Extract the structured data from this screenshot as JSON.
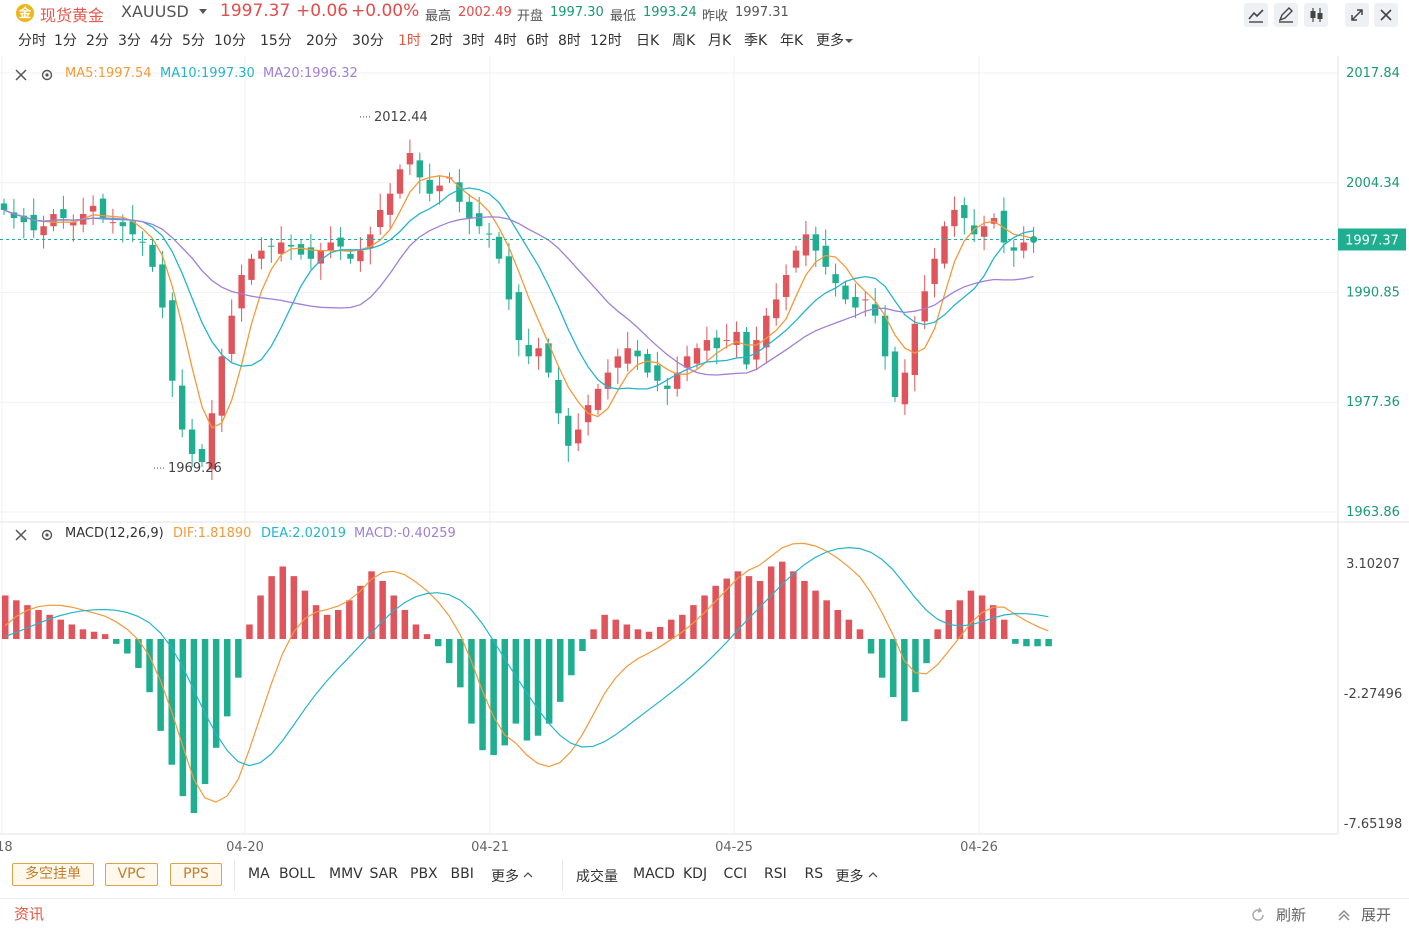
{
  "header": {
    "icon_glyph": "金",
    "name": "现货黄金",
    "code": "XAUUSD",
    "price": "1997.37",
    "change": "+0.06",
    "change_pct": "+0.00%",
    "high_label": "最高",
    "high": "2002.49",
    "open_label": "开盘",
    "open": "1997.30",
    "low_label": "最低",
    "low": "1993.24",
    "prev_label": "昨收",
    "prev": "1997.31"
  },
  "toolbar_icons": [
    "line-tool-icon",
    "draw-tool-icon",
    "candle-type-icon",
    "fullscreen-icon",
    "close-icon"
  ],
  "timeframes": [
    "分时",
    "1分",
    "2分",
    "3分",
    "4分",
    "5分",
    "10分",
    "15分",
    "20分",
    "30分",
    "1时",
    "2时",
    "3时",
    "4时",
    "6时",
    "8时",
    "12时",
    "日K",
    "周K",
    "月K",
    "季K",
    "年K",
    "更多"
  ],
  "active_timeframe": "1时",
  "main_legend": {
    "ma5": "MA5:1997.54",
    "ma10": "MA10:1997.30",
    "ma20": "MA20:1996.32"
  },
  "macd_legend": {
    "name": "MACD(12,26,9)",
    "dif": "DIF:1.81890",
    "dea": "DEA:2.02019",
    "macd": "MACD:-0.40259"
  },
  "colors": {
    "up": "#e0545c",
    "down": "#1fae8f",
    "ma5": "#f39a3b",
    "ma10": "#24b5cc",
    "ma20": "#a07fd6",
    "dif": "#f39a3b",
    "dea": "#24b5cc",
    "axis_text": "#1a9a72"
  },
  "chart_data": {
    "type": "candlestick",
    "x_labels": [
      "-18",
      "04-20",
      "04-21",
      "04-25",
      "04-26"
    ],
    "price_axis": [
      "2017.84",
      "2004.34",
      "1990.85",
      "1977.36",
      "1963.86"
    ],
    "current_price_label": "1997.37",
    "high_marker": "2012.44",
    "low_marker": "1969.26",
    "y_range": [
      1963.86,
      2017.84
    ],
    "close": [
      2001.0,
      2000.0,
      1999.5,
      1998.5,
      1999.0,
      2000.5,
      2000.0,
      1999.5,
      2000.5,
      2001.5,
      2000.0,
      1999.5,
      1999.0,
      1998.0,
      1997.0,
      1994.0,
      1989.0,
      1980.0,
      1974.0,
      1971.0,
      1970.0,
      1976.0,
      1983.0,
      1988.0,
      1993.0,
      1995.0,
      1996.0,
      1996.5,
      1997.0,
      1996.5,
      1995.5,
      1995.0,
      1996.0,
      1997.0,
      1996.5,
      1995.0,
      1996.0,
      1998.0,
      2001.0,
      2003.0,
      2006.0,
      2008.0,
      2005.0,
      2003.0,
      2004.0,
      2005.0,
      2002.0,
      2000.0,
      1999.0,
      1998.0,
      1995.0,
      1990.0,
      1985.0,
      1983.0,
      1984.0,
      1981.0,
      1976.0,
      1972.0,
      1974.0,
      1977.0,
      1979.0,
      1981.0,
      1983.0,
      1984.0,
      1983.0,
      1981.0,
      1980.0,
      1979.0,
      1981.0,
      1983.0,
      1984.0,
      1985.0,
      1984.0,
      1985.0,
      1986.0,
      1982.0,
      1985.0,
      1988.0,
      1990.0,
      1993.0,
      1996.0,
      1998.0,
      1996.0,
      1994.0,
      1992.0,
      1990.0,
      1989.0,
      1990.0,
      1988.0,
      1983.0,
      1978.0,
      1981.0,
      1987.0,
      1991.0,
      1995.0,
      1999.0,
      2001.0,
      2000.0,
      1998.0,
      1999.0,
      2000.0,
      1997.0,
      1996.0,
      1997.0,
      1997.37
    ],
    "ma_series": [
      "MA5",
      "MA10",
      "MA20"
    ],
    "macd": {
      "axis": [
        "3.10207",
        "-2.27496",
        "-7.65198"
      ],
      "y_range": [
        -7.65198,
        3.10207
      ],
      "hist": [
        1.8,
        1.6,
        1.4,
        1.2,
        1.0,
        0.8,
        0.6,
        0.4,
        0.3,
        0.2,
        -0.2,
        -0.6,
        -1.2,
        -2.2,
        -3.8,
        -5.2,
        -6.5,
        -7.2,
        -6.0,
        -4.5,
        -3.2,
        -1.6,
        0.6,
        1.8,
        2.6,
        3.0,
        2.6,
        2.0,
        1.4,
        1.0,
        1.2,
        1.6,
        2.2,
        2.8,
        2.4,
        1.8,
        1.2,
        0.6,
        0.2,
        -0.3,
        -1.0,
        -2.0,
        -3.5,
        -4.6,
        -4.8,
        -4.4,
        -3.5,
        -4.2,
        -4.0,
        -3.5,
        -2.6,
        -1.5,
        -0.5,
        0.4,
        1.0,
        0.8,
        0.6,
        0.4,
        0.3,
        0.5,
        0.8,
        1.0,
        1.4,
        1.8,
        2.2,
        2.5,
        2.8,
        2.6,
        2.4,
        3.0,
        3.2,
        2.8,
        2.4,
        2.0,
        1.6,
        1.2,
        0.8,
        0.4,
        -0.6,
        -1.6,
        -2.4,
        -3.4,
        -2.2,
        -1.0,
        0.4,
        1.2,
        1.6,
        2.0,
        1.8,
        1.4,
        0.8,
        -0.2,
        -0.3,
        -0.3,
        -0.3
      ]
    }
  },
  "indicator_bar": {
    "tags": [
      "多空挂单",
      "VPC",
      "PPS"
    ],
    "main_indicators": [
      "MA",
      "BOLL",
      "MMV",
      "SAR",
      "PBX",
      "BBI",
      "更多"
    ],
    "sub_indicators": [
      "成交量",
      "MACD",
      "KDJ",
      "CCI",
      "RSI",
      "RS",
      "更多"
    ]
  },
  "info_bar": {
    "label": "资讯",
    "refresh": "刷新",
    "expand": "展开"
  }
}
